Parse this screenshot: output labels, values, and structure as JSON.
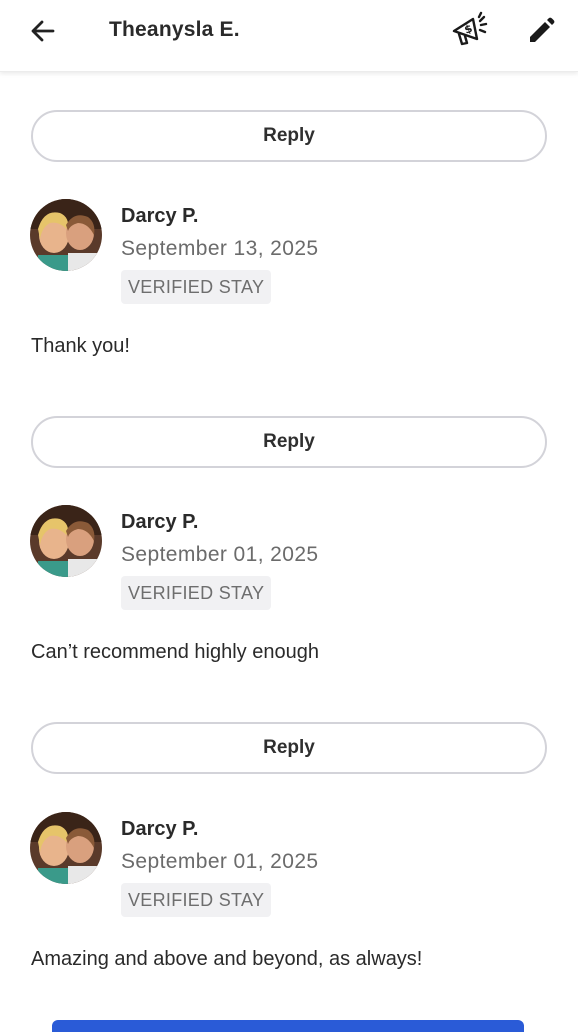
{
  "header": {
    "title": "Theanysla E.",
    "back_icon": "arrow-left-icon",
    "promo_icon": "megaphone-dollar-icon",
    "edit_icon": "pencil-icon"
  },
  "reply_label": "Reply",
  "reviews": [
    {
      "name": "Darcy P.",
      "date": "September 13, 2025",
      "badge": "VERIFIED STAY",
      "text": "Thank you!"
    },
    {
      "name": "Darcy P.",
      "date": "September 01, 2025",
      "badge": "VERIFIED STAY",
      "text": "Can’t recommend highly enough"
    },
    {
      "name": "Darcy P.",
      "date": "September 01, 2025",
      "badge": "VERIFIED STAY",
      "text": "Amazing and above and beyond, as always!"
    }
  ],
  "colors": {
    "button_border": "#d3d3d9",
    "badge_bg": "#f1f1f3",
    "accent_blue": "#2a5bd7"
  }
}
